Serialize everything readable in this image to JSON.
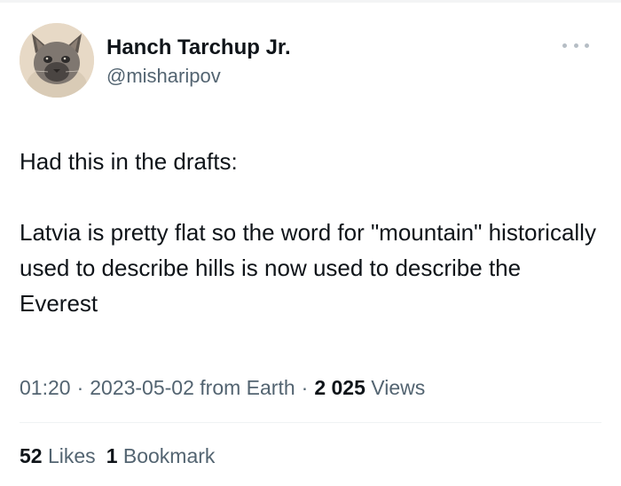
{
  "author": {
    "display_name": "Hanch Tarchup Jr.",
    "handle": "@misharipov",
    "avatar_icon": "cat-avatar-icon"
  },
  "more_icon": "more-dots-icon",
  "tweet": {
    "line1": "Had this in the drafts:",
    "line2": "Latvia is pretty flat so the word for \"mountain\" historically used to describe hills is now used to describe the Everest"
  },
  "meta": {
    "time": "01:20",
    "separator": "·",
    "date": "2023-05-02",
    "source": "from Earth",
    "views_count": "2 025",
    "views_label": "Views"
  },
  "stats": {
    "likes_count": "52",
    "likes_label": "Likes",
    "bookmarks_count": "1",
    "bookmarks_label": "Bookmark"
  },
  "colors": {
    "text": "#0f1419",
    "secondary": "#536471",
    "divider": "#eff3f4"
  }
}
